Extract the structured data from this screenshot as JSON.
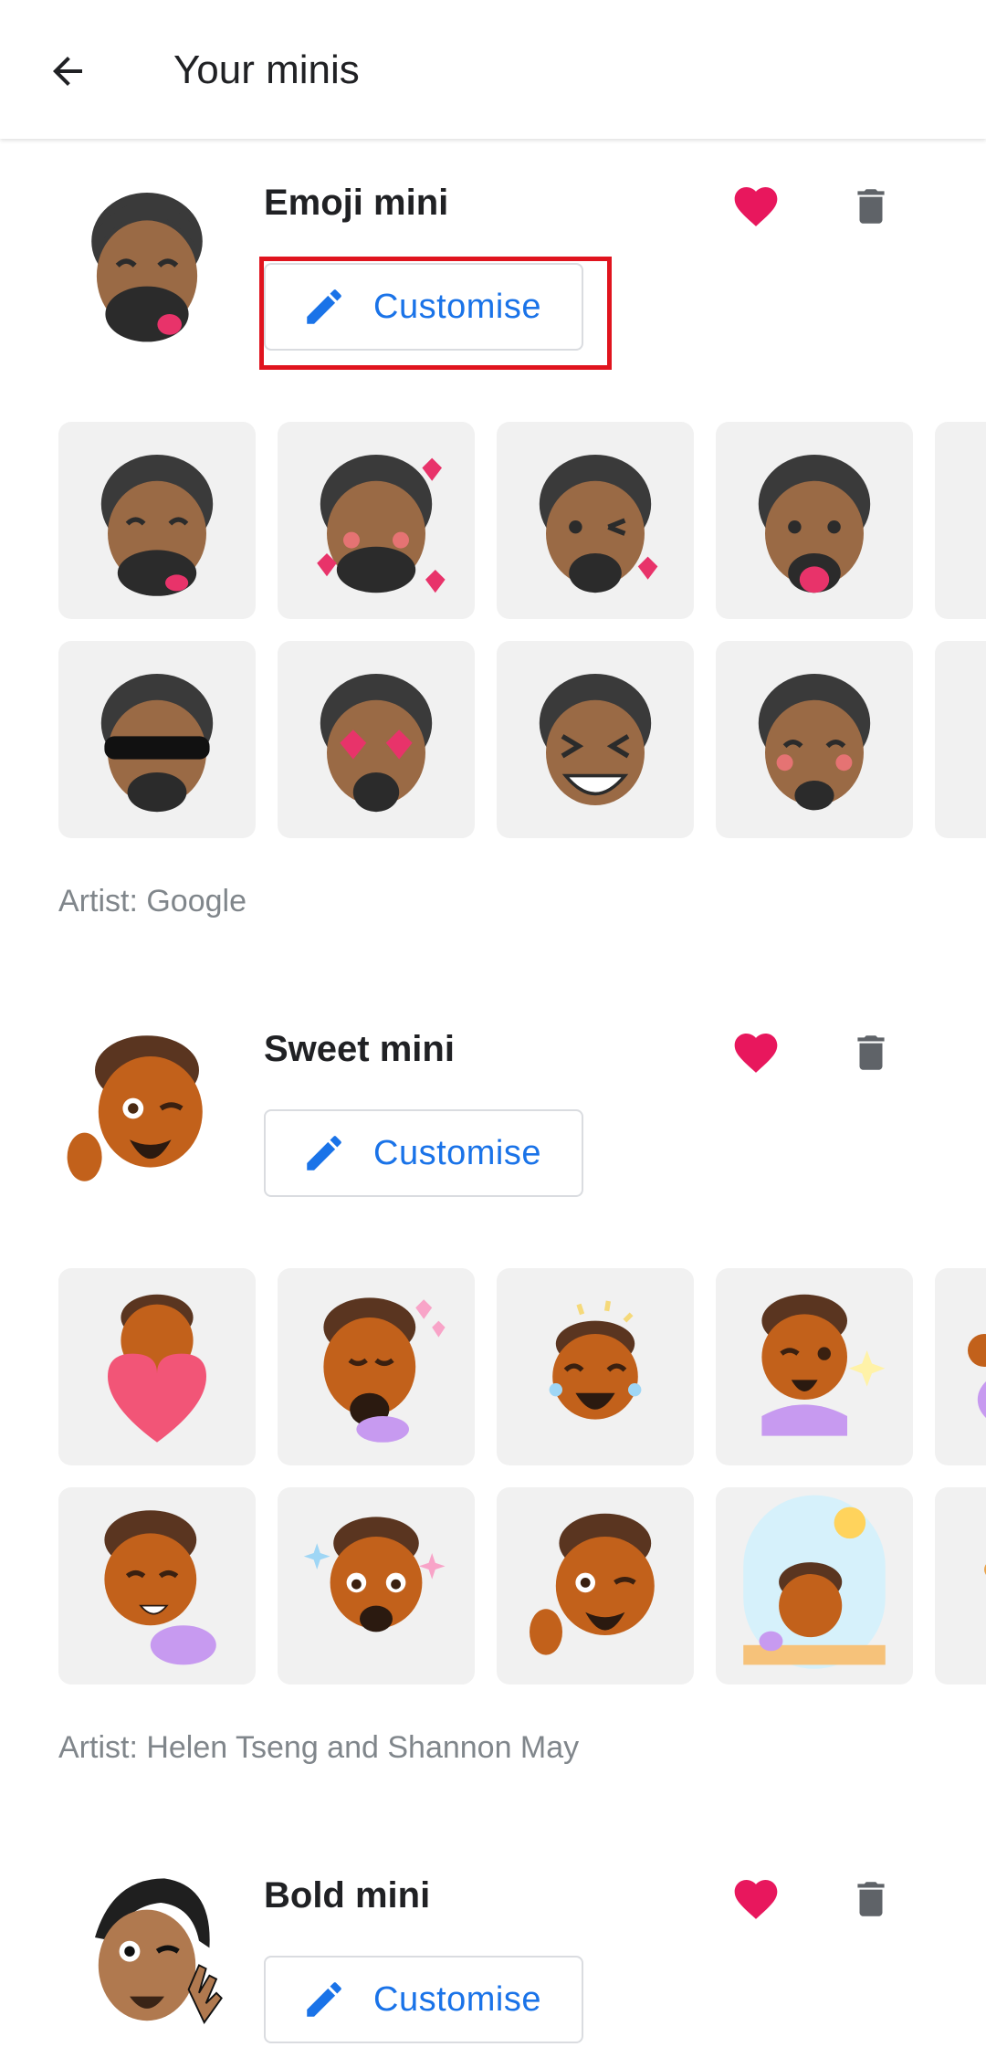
{
  "appbar": {
    "title": "Your minis",
    "back_icon": "arrow-back-icon"
  },
  "colors": {
    "accent": "#1a73e8",
    "heart": "#e8175d",
    "trash": "#5f6368",
    "highlight": "#e0141e",
    "tile_bg": "#f1f1f1"
  },
  "packs": [
    {
      "title": "Emoji mini",
      "customise_label": "Customise",
      "artist": "Artist: Google",
      "stickers_row1": [
        "laughing-tongue",
        "hearts-smile",
        "kiss-wink",
        "tongue-out",
        "partial"
      ],
      "stickers_row2": [
        "sunglasses",
        "heart-eyes",
        "squint-laugh",
        "smile-blush",
        "partial"
      ]
    },
    {
      "title": "Sweet mini",
      "customise_label": "Customise",
      "artist": "Artist: Helen Tseng and Shannon May",
      "stickers_row1": [
        "heart-hug",
        "blowing-hearts",
        "laughing-tears",
        "wink-sparkle",
        "partial"
      ],
      "stickers_row2": [
        "shy-smile",
        "teary-eyes",
        "thumbs-up-wink",
        "window-wave",
        "partial"
      ]
    },
    {
      "title": "Bold mini",
      "customise_label": "Customise"
    }
  ]
}
